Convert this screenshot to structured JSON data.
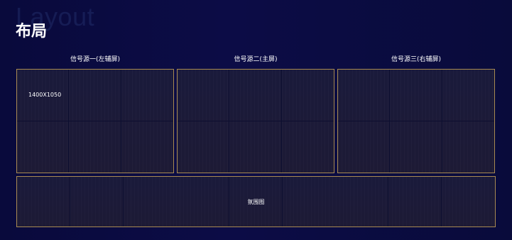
{
  "header": {
    "watermark": "Layout",
    "title": "布局"
  },
  "sources": [
    {
      "label": "信号源一(左辅屏)",
      "resolution": "1400X1050"
    },
    {
      "label": "信号源二(主屏)"
    },
    {
      "label": "信号源三(右辅屏)"
    }
  ],
  "ambience": {
    "label": "氛围图"
  },
  "colors": {
    "background": "#0b0c42",
    "panel_border": "#a88a52",
    "panel_fill": "#1c1a38",
    "text": "#ffffff"
  }
}
